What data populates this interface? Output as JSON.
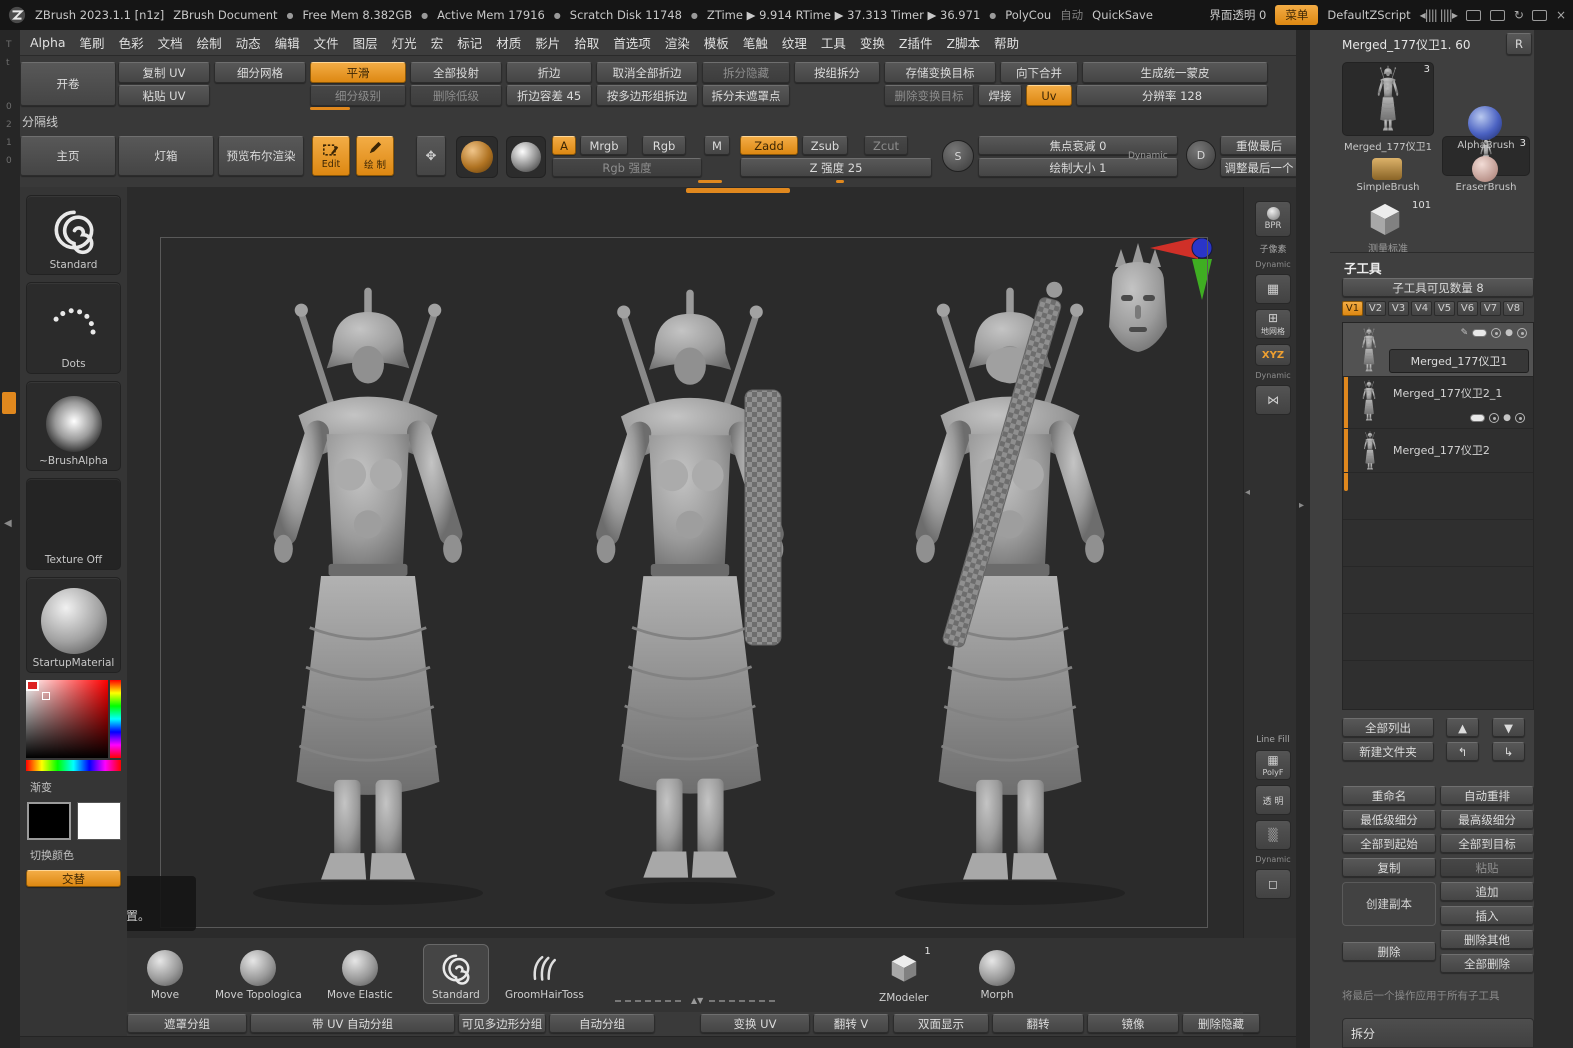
{
  "titlebar": {
    "app_title": "ZBrush 2023.1.1 [n1z]",
    "document": "ZBrush Document",
    "free_mem": "Free Mem 8.382GB",
    "active_mem": "Active Mem 17916",
    "scratch_disk": "Scratch Disk 11748",
    "timers": "ZTime ▶ 9.914 RTime ▶ 37.313 Timer ▶ 36.971",
    "polycount": "PolyCou",
    "auto": "自动",
    "quicksave": "QuickSave",
    "ui_transparency": "界面透明 0",
    "menu": "菜单",
    "zscript": "DefaultZScript"
  },
  "menubar": [
    "Alpha",
    "笔刷",
    "色彩",
    "文档",
    "绘制",
    "动态",
    "编辑",
    "文件",
    "图层",
    "灯光",
    "宏",
    "标记",
    "材质",
    "影片",
    "拾取",
    "首选项",
    "渲染",
    "模板",
    "笔触",
    "纹理",
    "工具",
    "变换",
    "Z插件",
    "Z脚本",
    "帮助"
  ],
  "shelf": {
    "unfold": "开卷",
    "copy_uv": "复制 UV",
    "paste_uv": "粘贴 UV",
    "divide": "细分网格",
    "smt": "平滑",
    "subdiv_level": "细分级别",
    "project_all": "全部投射",
    "del_lower": "删除低级",
    "crease": "折边",
    "crease_tolerance": "折边容差 45",
    "uncrease_all": "取消全部折边",
    "crease_pg": "按多边形组拆边",
    "split_hidden": "拆分隐藏",
    "split_unmasked": "拆分未遮罩点",
    "groups_split": "按组拆分",
    "store_mt": "存储变换目标",
    "del_mt": "删除变换目标",
    "merge_down": "向下合并",
    "make_adaptive_skin": "生成统一蒙皮",
    "weld": "焊接",
    "uv": "Uv",
    "resolution": "分辨率 128",
    "section_divider": "分隔线"
  },
  "topshelf": {
    "home": "主页",
    "lightbox": "灯箱",
    "preview_boolean": "预览布尔渲染",
    "edit": "Edit",
    "draw": "绘 制",
    "a": "A",
    "mrgb": "Mrgb",
    "rgb": "Rgb",
    "m": "M",
    "zadd": "Zadd",
    "zsub": "Zsub",
    "zcut": "Zcut",
    "rgb_intensity": "Rgb 强度",
    "z_intensity": "Z 强度 25",
    "focal_shift": "焦点衰减 0",
    "draw_size": "绘制大小 1",
    "dynamic": "Dynamic",
    "s": "S",
    "d": "D",
    "redo_last": "重做最后",
    "adjust_last": "调整最后一个"
  },
  "left_palette": {
    "brush": "Standard",
    "stroke": "Dots",
    "alpha": "~BrushAlpha",
    "texture": "Texture Off",
    "material": "StartupMaterial",
    "gradient": "渐变",
    "switch_color": "切换颜色",
    "alternate": "交替",
    "tooltip_title": "分隔线",
    "tooltip_text": "单击恢复先前位置。"
  },
  "canvas_strip": {
    "bpr": "BPR",
    "subpixel": "子像素",
    "dynamic_a": "Dynamic",
    "floor": "地网格",
    "xyz": "XYZ",
    "dynamic_b": "Dynamic",
    "line_fill": "Line Fill",
    "polyf": "PolyF",
    "transparent": "透 明",
    "dynamic_c": "Dynamic"
  },
  "right_panel": {
    "active_tool": "Merged_177仪卫1. 60",
    "r": "R",
    "tool_thumb_label": "Merged_177仪卫1",
    "tool_thumb_badge": "3",
    "recent_thumb_label": "Merged_177仪卫1",
    "recent_thumb_badge": "3",
    "alpha_brush": "AlphaBrush",
    "simple_brush": "SimpleBrush",
    "eraser_brush": "EraserBrush",
    "cube_badge": "101",
    "cube_label": "测量标准",
    "subtool": {
      "title": "子工具",
      "visible_count": "子工具可见数量 8",
      "tabs": [
        "V1",
        "V2",
        "V3",
        "V4",
        "V5",
        "V6",
        "V7",
        "V8"
      ],
      "items": [
        "Merged_177仪卫1",
        "Merged_177仪卫2_1",
        "Merged_177仪卫2"
      ],
      "list_all": "全部列出",
      "new_folder": "新建文件夹",
      "rename": "重命名",
      "auto_reorder": "自动重排",
      "lowest_subdiv": "最低级细分",
      "highest_subdiv": "最高级细分",
      "all_to_start": "全部到起始",
      "all_to_target": "全部到目标",
      "copy": "复制",
      "paste": "粘贴",
      "duplicate": "创建副本",
      "append": "追加",
      "insert": "插入",
      "delete": "删除",
      "delete_other": "删除其他",
      "delete_all": "全部删除",
      "apply_last_note": "将最后一个操作应用于所有子工具",
      "split": "拆分"
    }
  },
  "tray": {
    "brushes": [
      "Move",
      "Move Topologica",
      "Move Elastic",
      "Standard",
      "GroomHairToss",
      "ZModeler",
      "Morph"
    ],
    "zmodeler_badge": "1"
  },
  "bottom_bar": [
    "遮罩分组",
    "带 UV 自动分组",
    "可见多边形分组",
    "自动分组",
    "变换 UV",
    "翻转 V",
    "双面显示",
    "翻转",
    "镜像",
    "删除隐藏"
  ]
}
